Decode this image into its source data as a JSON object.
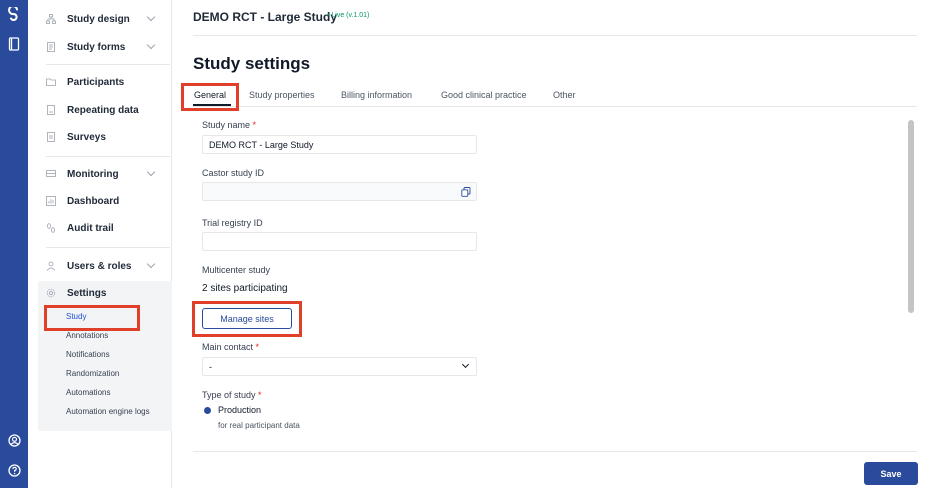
{
  "header": {
    "study_title": "DEMO RCT - Large Study",
    "status_badge": "• Live (v.1.01)"
  },
  "page": {
    "title": "Study settings"
  },
  "sidebar": {
    "items": {
      "study_design": "Study design",
      "study_forms": "Study forms",
      "participants": "Participants",
      "repeating_data": "Repeating data",
      "surveys": "Surveys",
      "monitoring": "Monitoring",
      "dashboard": "Dashboard",
      "audit_trail": "Audit trail",
      "users_roles": "Users & roles",
      "settings": "Settings"
    },
    "settings_sub": {
      "study": "Study",
      "annotations": "Annotations",
      "notifications": "Notifications",
      "randomization": "Randomization",
      "automations": "Automations",
      "automation_engine_logs": "Automation engine logs"
    }
  },
  "tabs": {
    "general": "General",
    "study_properties": "Study properties",
    "billing_information": "Billing information",
    "good_clinical_practice": "Good clinical practice",
    "other": "Other"
  },
  "form": {
    "study_name_label": "Study name",
    "study_name_value": "DEMO RCT - Large Study",
    "castor_id_label": "Castor study ID",
    "castor_id_value": "",
    "trial_registry_label": "Trial registry ID",
    "trial_registry_value": "",
    "multicenter_label": "Multicenter study",
    "sites_participating": "2 sites participating",
    "manage_sites_button": "Manage sites",
    "main_contact_label": "Main contact",
    "main_contact_value": "-",
    "type_of_study_label": "Type of study",
    "type_production": "Production",
    "type_production_desc": "for real participant data",
    "required_mark": "*"
  },
  "footer": {
    "save_button": "Save"
  },
  "colors": {
    "brand": "#2a4b9b",
    "highlight": "#e0402a",
    "live": "#059669",
    "required": "#dc2626"
  }
}
